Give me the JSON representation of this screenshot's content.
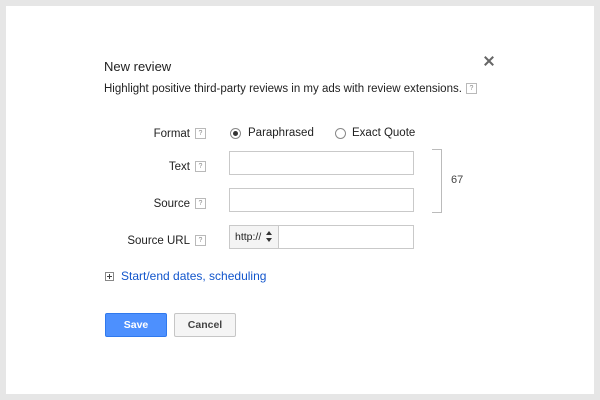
{
  "dialog": {
    "title": "New review",
    "description": "Highlight positive third-party reviews in my ads with review extensions.",
    "help_glyph": "?"
  },
  "format": {
    "label": "Format",
    "options": [
      "Paraphrased",
      "Exact Quote"
    ],
    "selected": "Paraphrased"
  },
  "text_field": {
    "label": "Text",
    "value": ""
  },
  "source_field": {
    "label": "Source",
    "value": ""
  },
  "char_counter": "67",
  "source_url": {
    "label": "Source URL",
    "protocol": "http://",
    "value": ""
  },
  "scheduling": {
    "link_label": "Start/end dates, scheduling"
  },
  "buttons": {
    "save": "Save",
    "cancel": "Cancel"
  },
  "colors": {
    "primary_button": "#4d90fe",
    "link": "#1155cc"
  }
}
